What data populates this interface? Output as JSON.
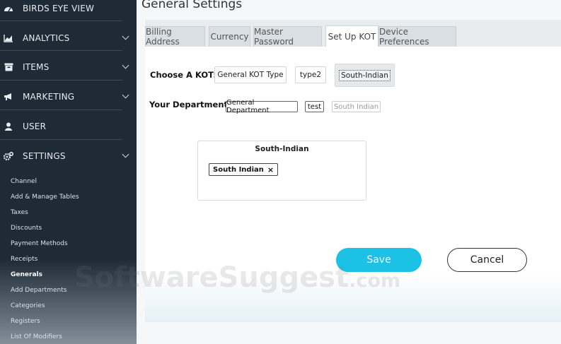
{
  "sidebar": {
    "items": [
      {
        "label": "BIRDS EYE VIEW",
        "icon": "dashboard-icon",
        "has_chevron": false
      },
      {
        "label": "ANALYTICS",
        "icon": "chart-icon",
        "has_chevron": true
      },
      {
        "label": "ITEMS",
        "icon": "box-icon",
        "has_chevron": true
      },
      {
        "label": "MARKETING",
        "icon": "megaphone-icon",
        "has_chevron": true
      },
      {
        "label": "USER",
        "icon": "user-icon",
        "has_chevron": false
      },
      {
        "label": "SETTINGS",
        "icon": "cogs-icon",
        "has_chevron": true
      }
    ],
    "settings_subitems": [
      "Channel",
      "Add & Manage Tables",
      "Taxes",
      "Discounts",
      "Payment Methods",
      "Receipts",
      "Generals",
      "Add Departments",
      "Categories",
      "Registers",
      "List Of Modifiers"
    ],
    "active_subitem": "Generals"
  },
  "page": {
    "title": "General Settings"
  },
  "tabs": [
    {
      "label": "Billing Address",
      "active": false
    },
    {
      "label": "Currency",
      "active": false
    },
    {
      "label": "Master Password",
      "active": false
    },
    {
      "label": "Set Up KOT",
      "active": true
    },
    {
      "label": "Device Preferences",
      "active": false
    }
  ],
  "kot": {
    "label": "Choose A KOT:",
    "options": [
      "General KOT Type",
      "type2",
      "South-Indian"
    ],
    "selected": "South-Indian"
  },
  "departments": {
    "label": "Your Departments :",
    "items": [
      {
        "label": "General Department",
        "enabled": true
      },
      {
        "label": "test",
        "enabled": true
      },
      {
        "label": "South Indian",
        "enabled": false
      }
    ]
  },
  "card": {
    "title": "South-Indian",
    "tags": [
      {
        "label": "South Indian",
        "remove": "×"
      }
    ]
  },
  "actions": {
    "save": "Save",
    "cancel": "Cancel"
  },
  "watermark": {
    "main": "SoftwareSuggest",
    "suffix": ".com"
  },
  "colors": {
    "sidebar_bg": "#1e2a36",
    "save_button": "#1cc1e6"
  }
}
